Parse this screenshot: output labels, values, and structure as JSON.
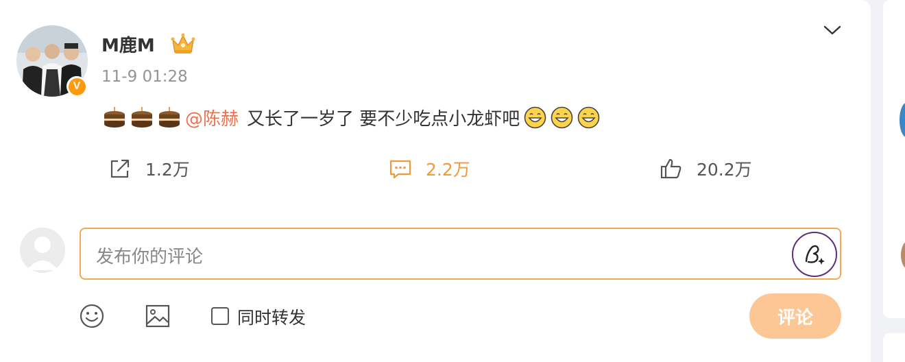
{
  "post": {
    "username": "M鹿M",
    "verified_badge": "V",
    "timestamp": "11-9 01:28",
    "content": {
      "emoji_prefix": [
        "cake-emoji",
        "cake-emoji",
        "cake-emoji"
      ],
      "mention": "@陈赫",
      "text": "又长了一岁了 要不少吃点小龙虾吧",
      "emoji_suffix": [
        "grin-emoji",
        "grin-emoji",
        "grin-emoji"
      ]
    },
    "actions": {
      "share_count": "1.2万",
      "comment_count": "2.2万",
      "like_count": "20.2万"
    }
  },
  "comment_box": {
    "placeholder": "发布你的评论",
    "repost_label": "同时转发",
    "submit_label": "评论"
  },
  "colors": {
    "accent_orange": "#f09a3c",
    "mention": "#eb7350",
    "input_border": "#f5a952",
    "submit_bg": "#fcc795"
  },
  "icons": {
    "more": "chevron-down-icon",
    "share": "share-icon",
    "comment": "comment-icon",
    "like": "thumbs-up-icon",
    "emoji": "emoji-icon",
    "image": "image-icon",
    "pen": "pen-icon"
  }
}
